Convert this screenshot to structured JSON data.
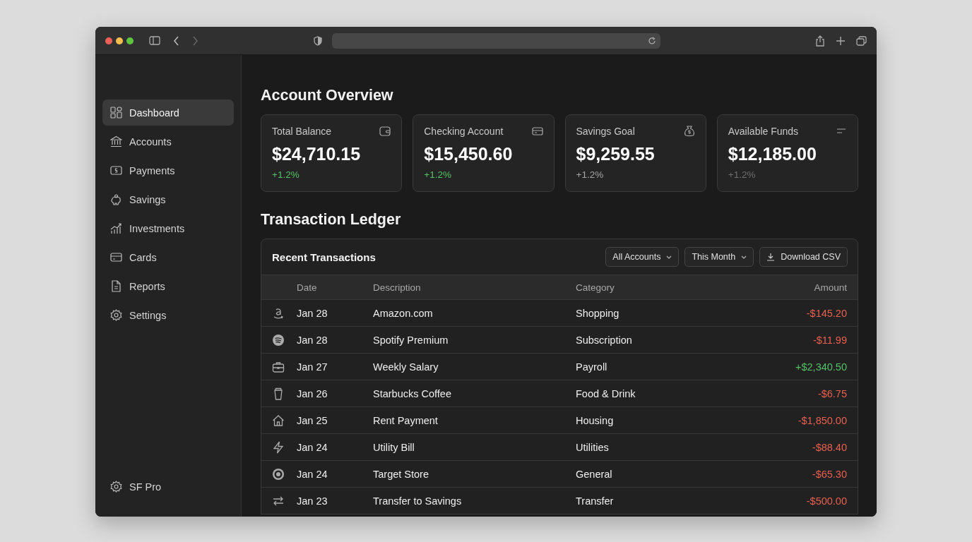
{
  "sidebar": {
    "items": [
      {
        "label": "Dashboard",
        "selected": true
      },
      {
        "label": "Accounts",
        "selected": false
      },
      {
        "label": "Payments",
        "selected": false
      },
      {
        "label": "Savings",
        "selected": false
      },
      {
        "label": "Investments",
        "selected": false
      },
      {
        "label": "Cards",
        "selected": false
      },
      {
        "label": "Reports",
        "selected": false
      },
      {
        "label": "Settings",
        "selected": false
      }
    ],
    "footer": {
      "label": "SF Pro"
    }
  },
  "overview": {
    "title": "Account Overview",
    "cards": [
      {
        "title": "Total Balance",
        "amount": "$24,710.15",
        "change": "+1.2%",
        "kind": "positive"
      },
      {
        "title": "Checking Account",
        "amount": "$15,450.60",
        "change": "+1.2%",
        "kind": "positive"
      },
      {
        "title": "Savings Goal",
        "amount": "$9,259.55",
        "change": "+1.2%",
        "kind": "neutral"
      },
      {
        "title": "Available Funds",
        "amount": "$12,185.00",
        "change": "+1.2%",
        "kind": "muted"
      }
    ]
  },
  "ledger": {
    "title": "Transaction Ledger",
    "panel_title": "Recent Transactions",
    "filters": [
      "All Accounts",
      "This Month"
    ],
    "download": "Download CSV",
    "columns": [
      "Date",
      "Description",
      "Category",
      "Amount"
    ],
    "rows": [
      {
        "date": "Jan 28",
        "description": "Amazon.com",
        "category": "Shopping",
        "amount": "-$145.20",
        "kind": "debit"
      },
      {
        "date": "Jan 28",
        "description": "Spotify Premium",
        "category": "Subscription",
        "amount": "-$11.99",
        "kind": "debit"
      },
      {
        "date": "Jan 27",
        "description": "Weekly Salary",
        "category": "Payroll",
        "amount": "+$2,340.50",
        "kind": "credit"
      },
      {
        "date": "Jan 26",
        "description": "Starbucks Coffee",
        "category": "Food & Drink",
        "amount": "-$6.75",
        "kind": "debit"
      },
      {
        "date": "Jan 25",
        "description": "Rent Payment",
        "category": "Housing",
        "amount": "-$1,850.00",
        "kind": "debit"
      },
      {
        "date": "Jan 24",
        "description": "Utility Bill",
        "category": "Utilities",
        "amount": "-$88.40",
        "kind": "debit"
      },
      {
        "date": "Jan 24",
        "description": "Target Store",
        "category": "General",
        "amount": "-$65.30",
        "kind": "debit"
      },
      {
        "date": "Jan 23",
        "description": "Transfer to Savings",
        "category": "Transfer",
        "amount": "-$500.00",
        "kind": "debit"
      }
    ]
  }
}
